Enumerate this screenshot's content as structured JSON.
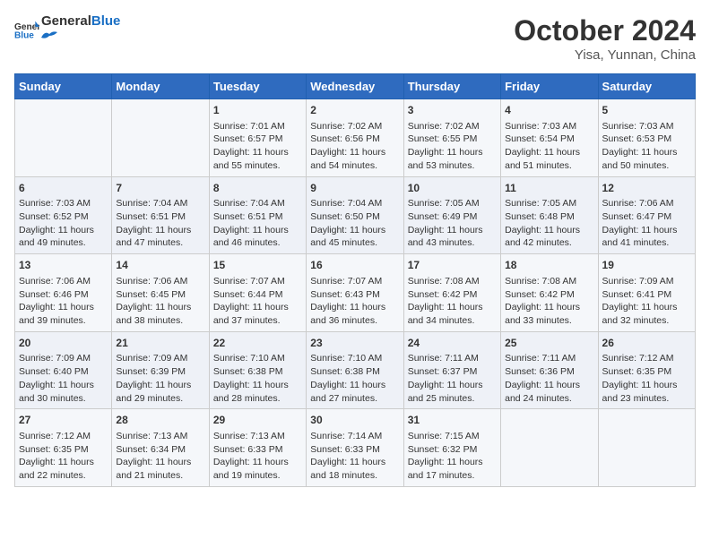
{
  "header": {
    "logo_general": "General",
    "logo_blue": "Blue",
    "title": "October 2024",
    "location": "Yisa, Yunnan, China"
  },
  "columns": [
    "Sunday",
    "Monday",
    "Tuesday",
    "Wednesday",
    "Thursday",
    "Friday",
    "Saturday"
  ],
  "weeks": [
    [
      {
        "day": "",
        "sunrise": "",
        "sunset": "",
        "daylight": ""
      },
      {
        "day": "",
        "sunrise": "",
        "sunset": "",
        "daylight": ""
      },
      {
        "day": "1",
        "sunrise": "Sunrise: 7:01 AM",
        "sunset": "Sunset: 6:57 PM",
        "daylight": "Daylight: 11 hours and 55 minutes."
      },
      {
        "day": "2",
        "sunrise": "Sunrise: 7:02 AM",
        "sunset": "Sunset: 6:56 PM",
        "daylight": "Daylight: 11 hours and 54 minutes."
      },
      {
        "day": "3",
        "sunrise": "Sunrise: 7:02 AM",
        "sunset": "Sunset: 6:55 PM",
        "daylight": "Daylight: 11 hours and 53 minutes."
      },
      {
        "day": "4",
        "sunrise": "Sunrise: 7:03 AM",
        "sunset": "Sunset: 6:54 PM",
        "daylight": "Daylight: 11 hours and 51 minutes."
      },
      {
        "day": "5",
        "sunrise": "Sunrise: 7:03 AM",
        "sunset": "Sunset: 6:53 PM",
        "daylight": "Daylight: 11 hours and 50 minutes."
      }
    ],
    [
      {
        "day": "6",
        "sunrise": "Sunrise: 7:03 AM",
        "sunset": "Sunset: 6:52 PM",
        "daylight": "Daylight: 11 hours and 49 minutes."
      },
      {
        "day": "7",
        "sunrise": "Sunrise: 7:04 AM",
        "sunset": "Sunset: 6:51 PM",
        "daylight": "Daylight: 11 hours and 47 minutes."
      },
      {
        "day": "8",
        "sunrise": "Sunrise: 7:04 AM",
        "sunset": "Sunset: 6:51 PM",
        "daylight": "Daylight: 11 hours and 46 minutes."
      },
      {
        "day": "9",
        "sunrise": "Sunrise: 7:04 AM",
        "sunset": "Sunset: 6:50 PM",
        "daylight": "Daylight: 11 hours and 45 minutes."
      },
      {
        "day": "10",
        "sunrise": "Sunrise: 7:05 AM",
        "sunset": "Sunset: 6:49 PM",
        "daylight": "Daylight: 11 hours and 43 minutes."
      },
      {
        "day": "11",
        "sunrise": "Sunrise: 7:05 AM",
        "sunset": "Sunset: 6:48 PM",
        "daylight": "Daylight: 11 hours and 42 minutes."
      },
      {
        "day": "12",
        "sunrise": "Sunrise: 7:06 AM",
        "sunset": "Sunset: 6:47 PM",
        "daylight": "Daylight: 11 hours and 41 minutes."
      }
    ],
    [
      {
        "day": "13",
        "sunrise": "Sunrise: 7:06 AM",
        "sunset": "Sunset: 6:46 PM",
        "daylight": "Daylight: 11 hours and 39 minutes."
      },
      {
        "day": "14",
        "sunrise": "Sunrise: 7:06 AM",
        "sunset": "Sunset: 6:45 PM",
        "daylight": "Daylight: 11 hours and 38 minutes."
      },
      {
        "day": "15",
        "sunrise": "Sunrise: 7:07 AM",
        "sunset": "Sunset: 6:44 PM",
        "daylight": "Daylight: 11 hours and 37 minutes."
      },
      {
        "day": "16",
        "sunrise": "Sunrise: 7:07 AM",
        "sunset": "Sunset: 6:43 PM",
        "daylight": "Daylight: 11 hours and 36 minutes."
      },
      {
        "day": "17",
        "sunrise": "Sunrise: 7:08 AM",
        "sunset": "Sunset: 6:42 PM",
        "daylight": "Daylight: 11 hours and 34 minutes."
      },
      {
        "day": "18",
        "sunrise": "Sunrise: 7:08 AM",
        "sunset": "Sunset: 6:42 PM",
        "daylight": "Daylight: 11 hours and 33 minutes."
      },
      {
        "day": "19",
        "sunrise": "Sunrise: 7:09 AM",
        "sunset": "Sunset: 6:41 PM",
        "daylight": "Daylight: 11 hours and 32 minutes."
      }
    ],
    [
      {
        "day": "20",
        "sunrise": "Sunrise: 7:09 AM",
        "sunset": "Sunset: 6:40 PM",
        "daylight": "Daylight: 11 hours and 30 minutes."
      },
      {
        "day": "21",
        "sunrise": "Sunrise: 7:09 AM",
        "sunset": "Sunset: 6:39 PM",
        "daylight": "Daylight: 11 hours and 29 minutes."
      },
      {
        "day": "22",
        "sunrise": "Sunrise: 7:10 AM",
        "sunset": "Sunset: 6:38 PM",
        "daylight": "Daylight: 11 hours and 28 minutes."
      },
      {
        "day": "23",
        "sunrise": "Sunrise: 7:10 AM",
        "sunset": "Sunset: 6:38 PM",
        "daylight": "Daylight: 11 hours and 27 minutes."
      },
      {
        "day": "24",
        "sunrise": "Sunrise: 7:11 AM",
        "sunset": "Sunset: 6:37 PM",
        "daylight": "Daylight: 11 hours and 25 minutes."
      },
      {
        "day": "25",
        "sunrise": "Sunrise: 7:11 AM",
        "sunset": "Sunset: 6:36 PM",
        "daylight": "Daylight: 11 hours and 24 minutes."
      },
      {
        "day": "26",
        "sunrise": "Sunrise: 7:12 AM",
        "sunset": "Sunset: 6:35 PM",
        "daylight": "Daylight: 11 hours and 23 minutes."
      }
    ],
    [
      {
        "day": "27",
        "sunrise": "Sunrise: 7:12 AM",
        "sunset": "Sunset: 6:35 PM",
        "daylight": "Daylight: 11 hours and 22 minutes."
      },
      {
        "day": "28",
        "sunrise": "Sunrise: 7:13 AM",
        "sunset": "Sunset: 6:34 PM",
        "daylight": "Daylight: 11 hours and 21 minutes."
      },
      {
        "day": "29",
        "sunrise": "Sunrise: 7:13 AM",
        "sunset": "Sunset: 6:33 PM",
        "daylight": "Daylight: 11 hours and 19 minutes."
      },
      {
        "day": "30",
        "sunrise": "Sunrise: 7:14 AM",
        "sunset": "Sunset: 6:33 PM",
        "daylight": "Daylight: 11 hours and 18 minutes."
      },
      {
        "day": "31",
        "sunrise": "Sunrise: 7:15 AM",
        "sunset": "Sunset: 6:32 PM",
        "daylight": "Daylight: 11 hours and 17 minutes."
      },
      {
        "day": "",
        "sunrise": "",
        "sunset": "",
        "daylight": ""
      },
      {
        "day": "",
        "sunrise": "",
        "sunset": "",
        "daylight": ""
      }
    ]
  ]
}
